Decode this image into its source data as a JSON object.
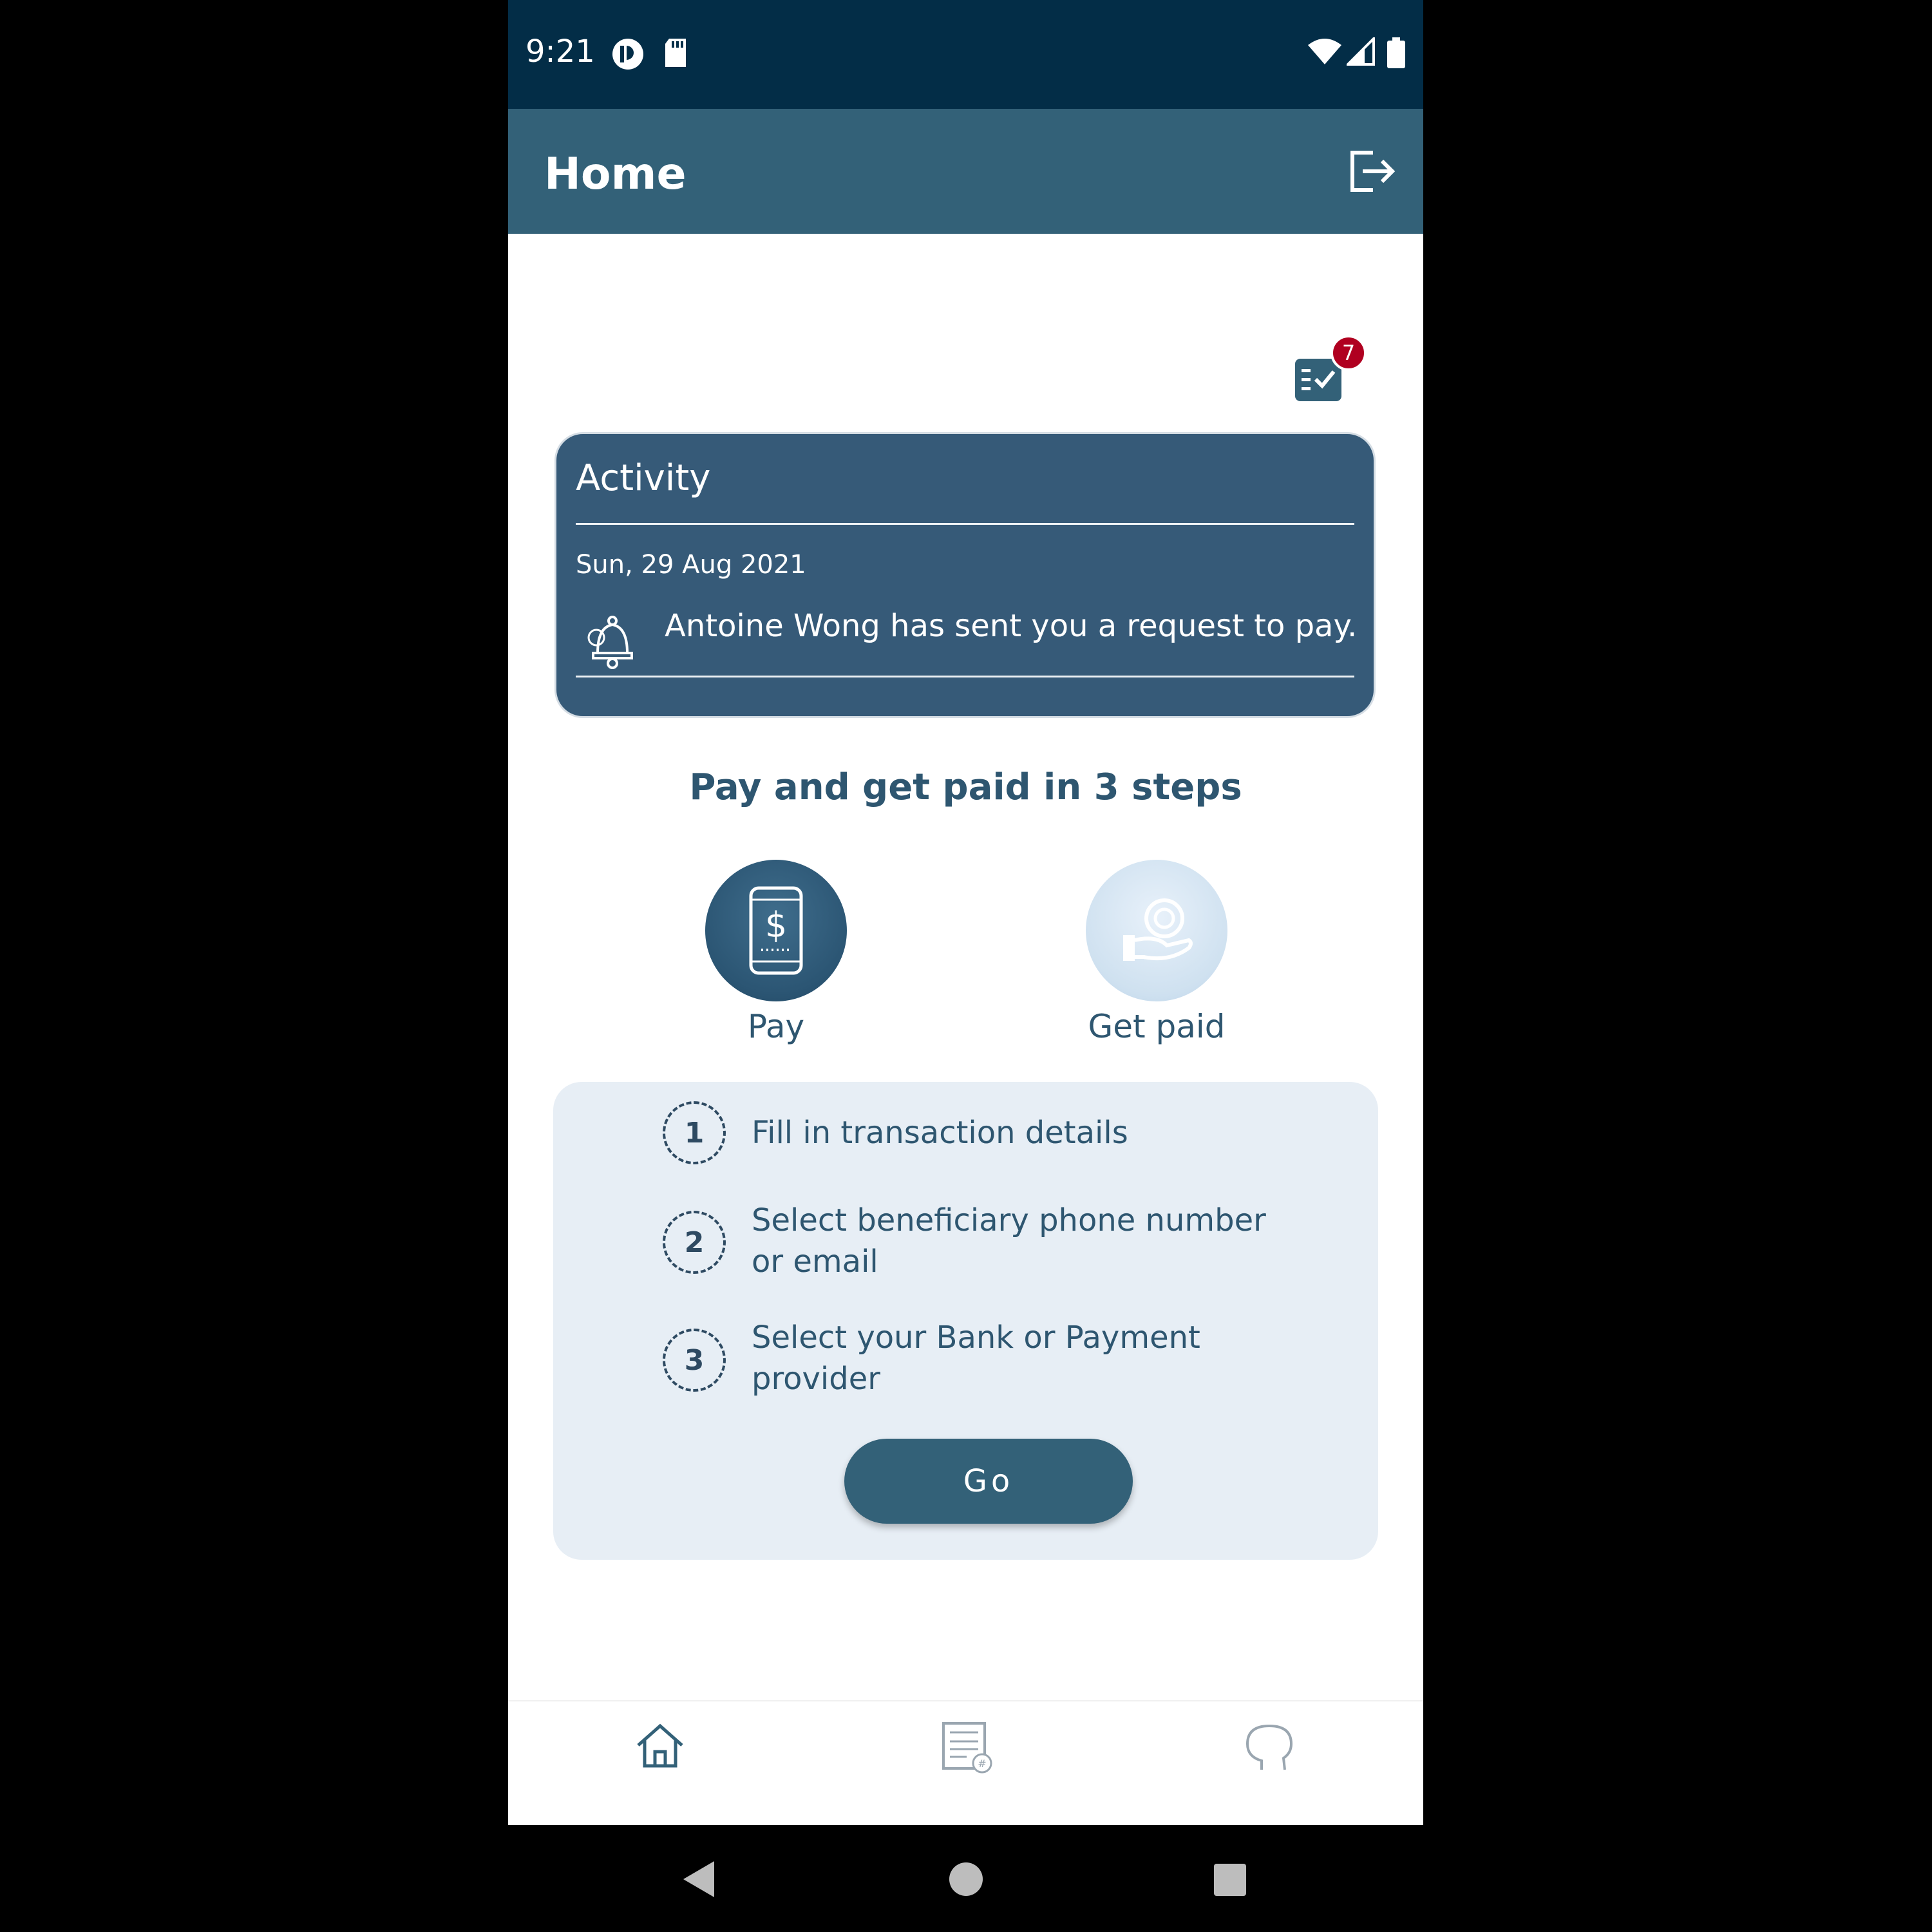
{
  "status_bar": {
    "time": "9:21"
  },
  "app_bar": {
    "title": "Home"
  },
  "notifications": {
    "count": "7"
  },
  "activity": {
    "title": "Activity",
    "date": "Sun, 29 Aug 2021",
    "message": "Antoine Wong has sent you a request to pay."
  },
  "steps": {
    "title": "Pay and get paid in 3 steps",
    "modes": [
      {
        "label": "Pay",
        "selected": true
      },
      {
        "label": "Get paid",
        "selected": false
      }
    ],
    "items": [
      {
        "number": "1",
        "text": "Fill in transaction details"
      },
      {
        "number": "2",
        "text": "Select beneficiary phone number or email"
      },
      {
        "number": "3",
        "text": "Select your Bank or Payment provider"
      }
    ],
    "go_label": "Go"
  },
  "bottom_nav": {
    "items": [
      {
        "icon": "home-icon",
        "selected": true
      },
      {
        "icon": "transactions-icon",
        "selected": false
      },
      {
        "icon": "support-icon",
        "selected": false
      }
    ]
  },
  "colors": {
    "status_bar": "#032d47",
    "app_bar": "#336178",
    "accent": "#2e5670",
    "badge": "#b00020",
    "panel": "#e7eef5"
  }
}
